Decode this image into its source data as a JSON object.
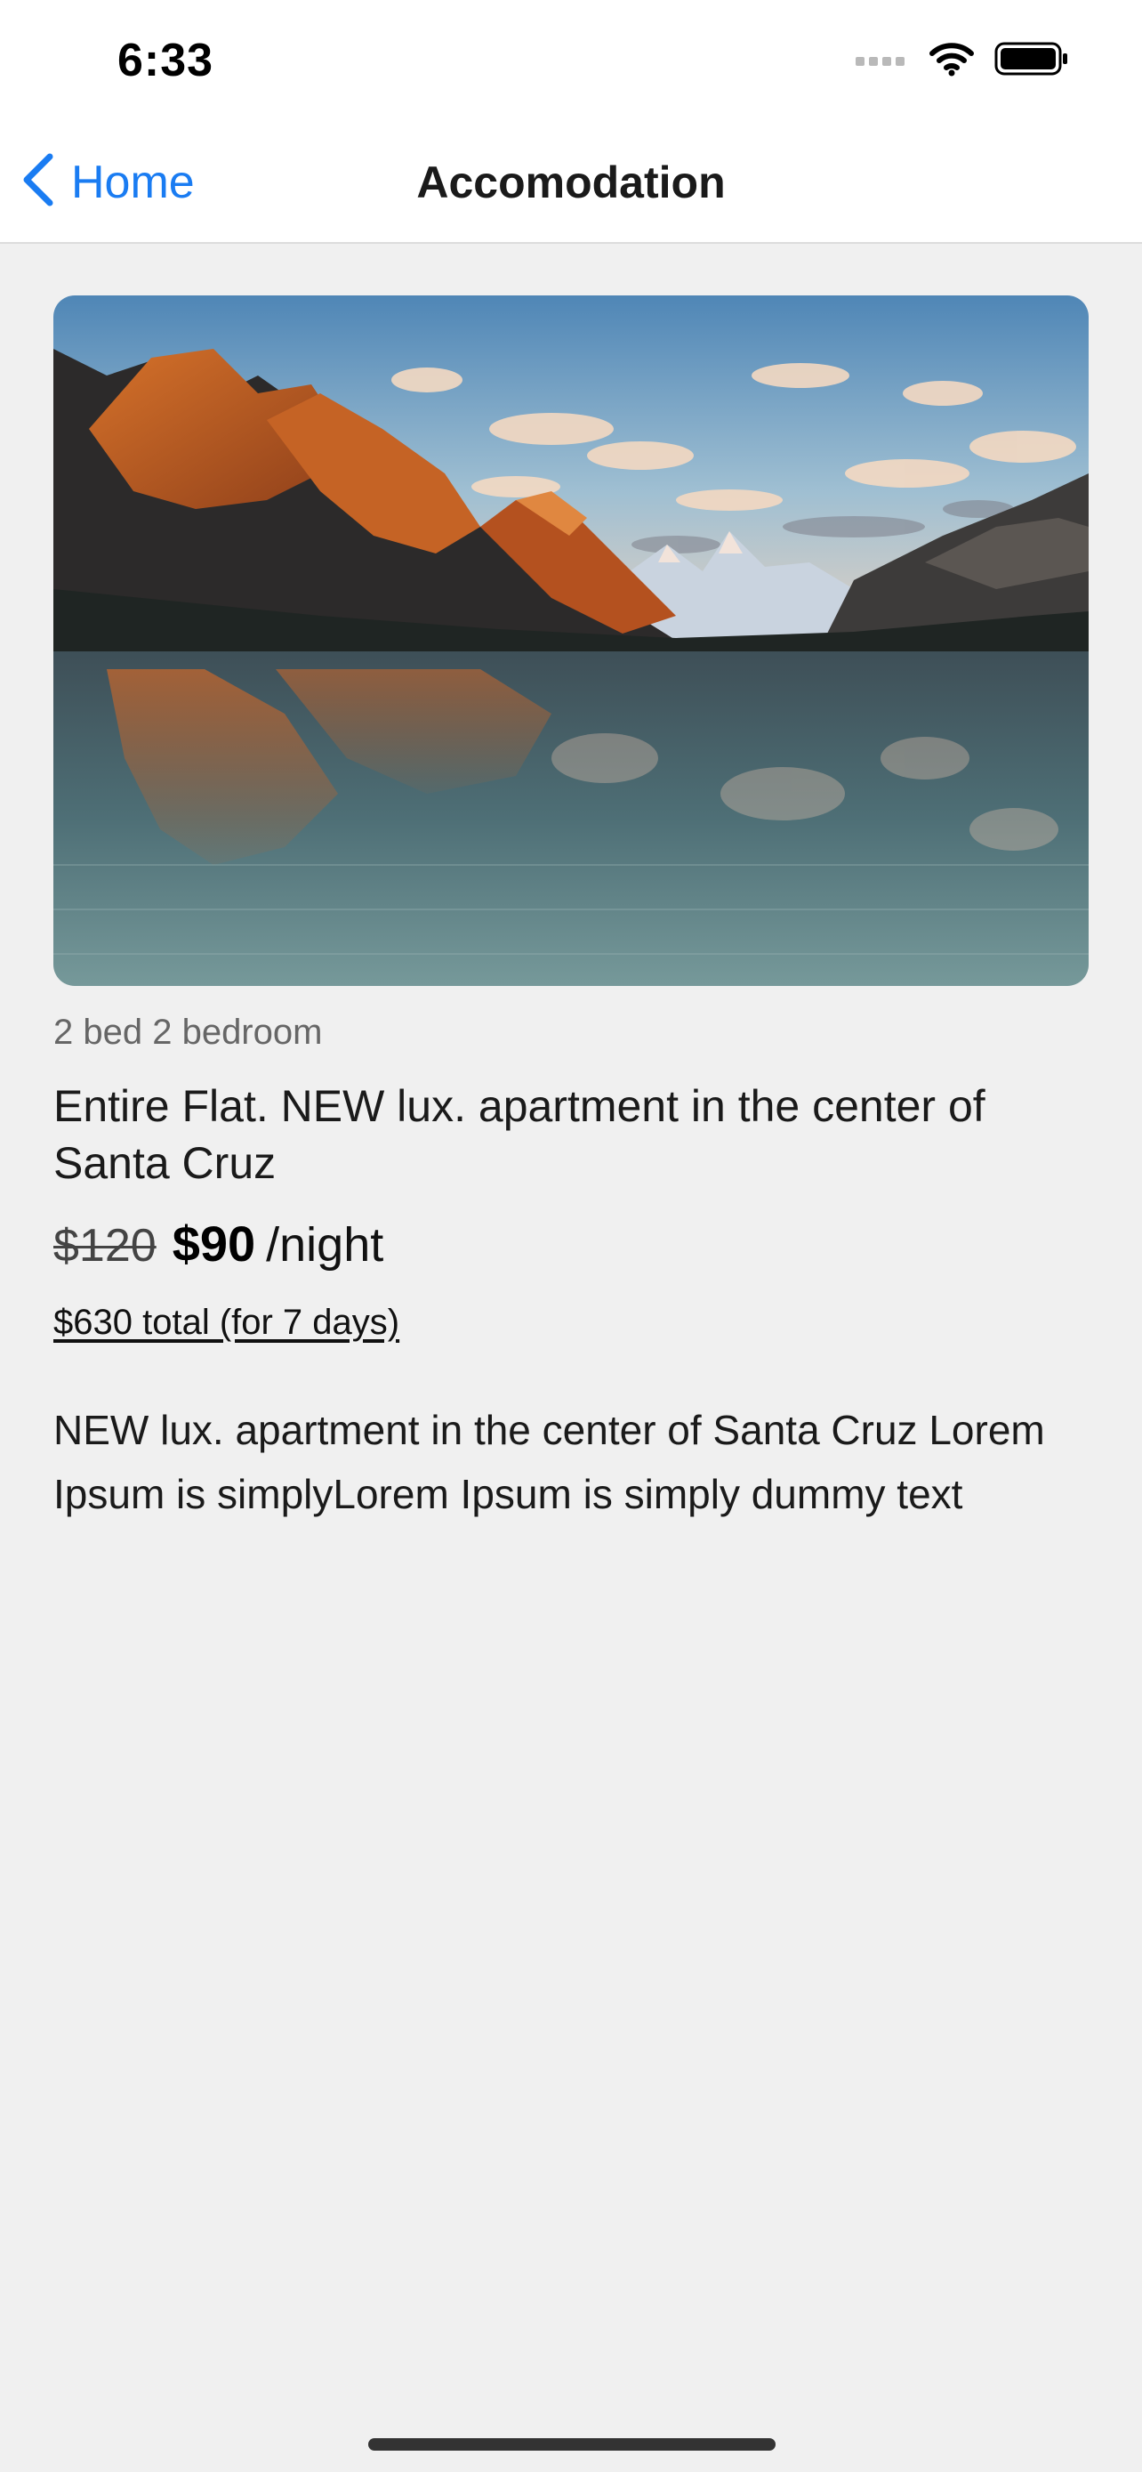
{
  "status_bar": {
    "time": "6:33"
  },
  "nav": {
    "back_label": "Home",
    "title": "Accomodation"
  },
  "listing": {
    "bed_info": "2 bed 2 bedroom",
    "title": "Entire Flat. NEW lux. apartment in the center of Santa Cruz",
    "price_old": "$120",
    "price_new": "$90",
    "price_unit": "/night",
    "total": "$630 total (for 7 days)",
    "description": "NEW lux. apartment in the center of Santa Cruz Lorem Ipsum is simplyLorem Ipsum is simply dummy text"
  },
  "colors": {
    "accent": "#1a7cf2",
    "background": "#f0f0f0"
  },
  "icons": {
    "back": "chevron-left-icon",
    "signal": "signal-icon",
    "wifi": "wifi-icon",
    "battery": "battery-icon"
  }
}
